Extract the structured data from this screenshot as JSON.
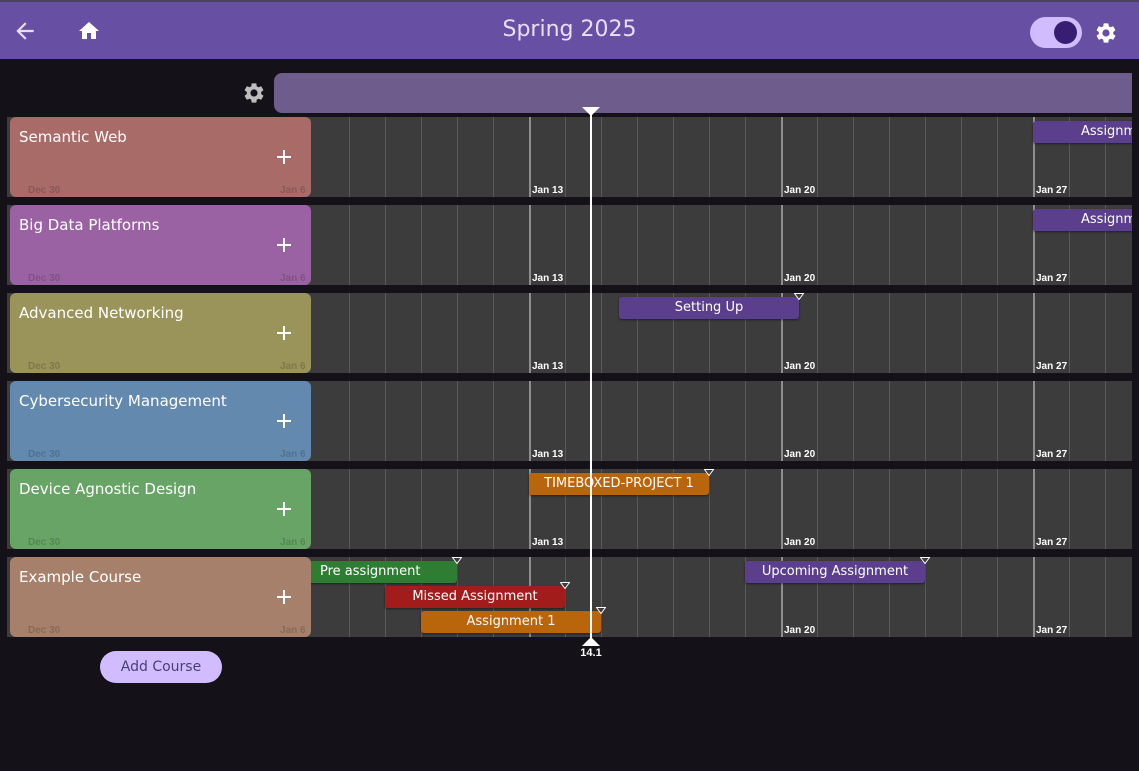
{
  "header": {
    "title": "Spring 2025",
    "back_icon": "arrow-back-icon",
    "home_icon": "home-icon",
    "toggle_on": true,
    "settings_icon": "settings-icon"
  },
  "colors": {
    "app_bar": "#6750a4",
    "background": "#141218",
    "track": "#3c3c3c",
    "purple_item": "#5b3f8c",
    "orange_item": "#b9650c",
    "green_item": "#2e7d32",
    "red_item": "#a31c1c"
  },
  "timeline": {
    "week_labels": [
      "Jan 13",
      "Jan 20",
      "Jan 27"
    ],
    "card_week_labels": [
      "Dec 30",
      "Jan 6"
    ],
    "now_label": "14.1"
  },
  "courses": [
    {
      "name": "Semantic Web",
      "color": "#a86b68",
      "items": [
        {
          "label": "Assignm"
        }
      ]
    },
    {
      "name": "Big Data Platforms",
      "color": "#9a62a3",
      "items": [
        {
          "label": "Assignm"
        }
      ]
    },
    {
      "name": "Advanced Networking",
      "color": "#9a935a",
      "items": [
        {
          "label": "Setting Up"
        }
      ]
    },
    {
      "name": "Cybersecurity Management",
      "color": "#6389ae",
      "items": []
    },
    {
      "name": "Device Agnostic Design",
      "color": "#67a466",
      "items": [
        {
          "label": "TIMEBOXED-PROJECT 1"
        }
      ]
    },
    {
      "name": "Example Course",
      "color": "#a6806a",
      "items": [
        {
          "label": "Pre assignment"
        },
        {
          "label": "Missed Assignment"
        },
        {
          "label": "Assignment 1"
        },
        {
          "label": "Upcoming Assignment"
        }
      ]
    }
  ],
  "add_course_label": "Add Course"
}
